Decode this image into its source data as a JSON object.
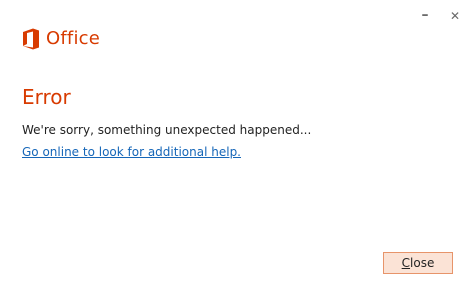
{
  "window": {
    "minimize_glyph": "–",
    "close_glyph": "✕"
  },
  "brand": {
    "logo_icon": "office-logo-icon",
    "name": "Office",
    "color": "#d83b01"
  },
  "dialog": {
    "heading": "Error",
    "message": "We're sorry, something unexpected happened...",
    "help_link": "Go online to look for additional help."
  },
  "buttons": {
    "close_mnemonic": "C",
    "close_rest": "lose"
  },
  "colors": {
    "accent": "#d83b01",
    "link": "#1566b8",
    "button_bg": "#fbe3d6",
    "button_border": "#e7946a"
  }
}
